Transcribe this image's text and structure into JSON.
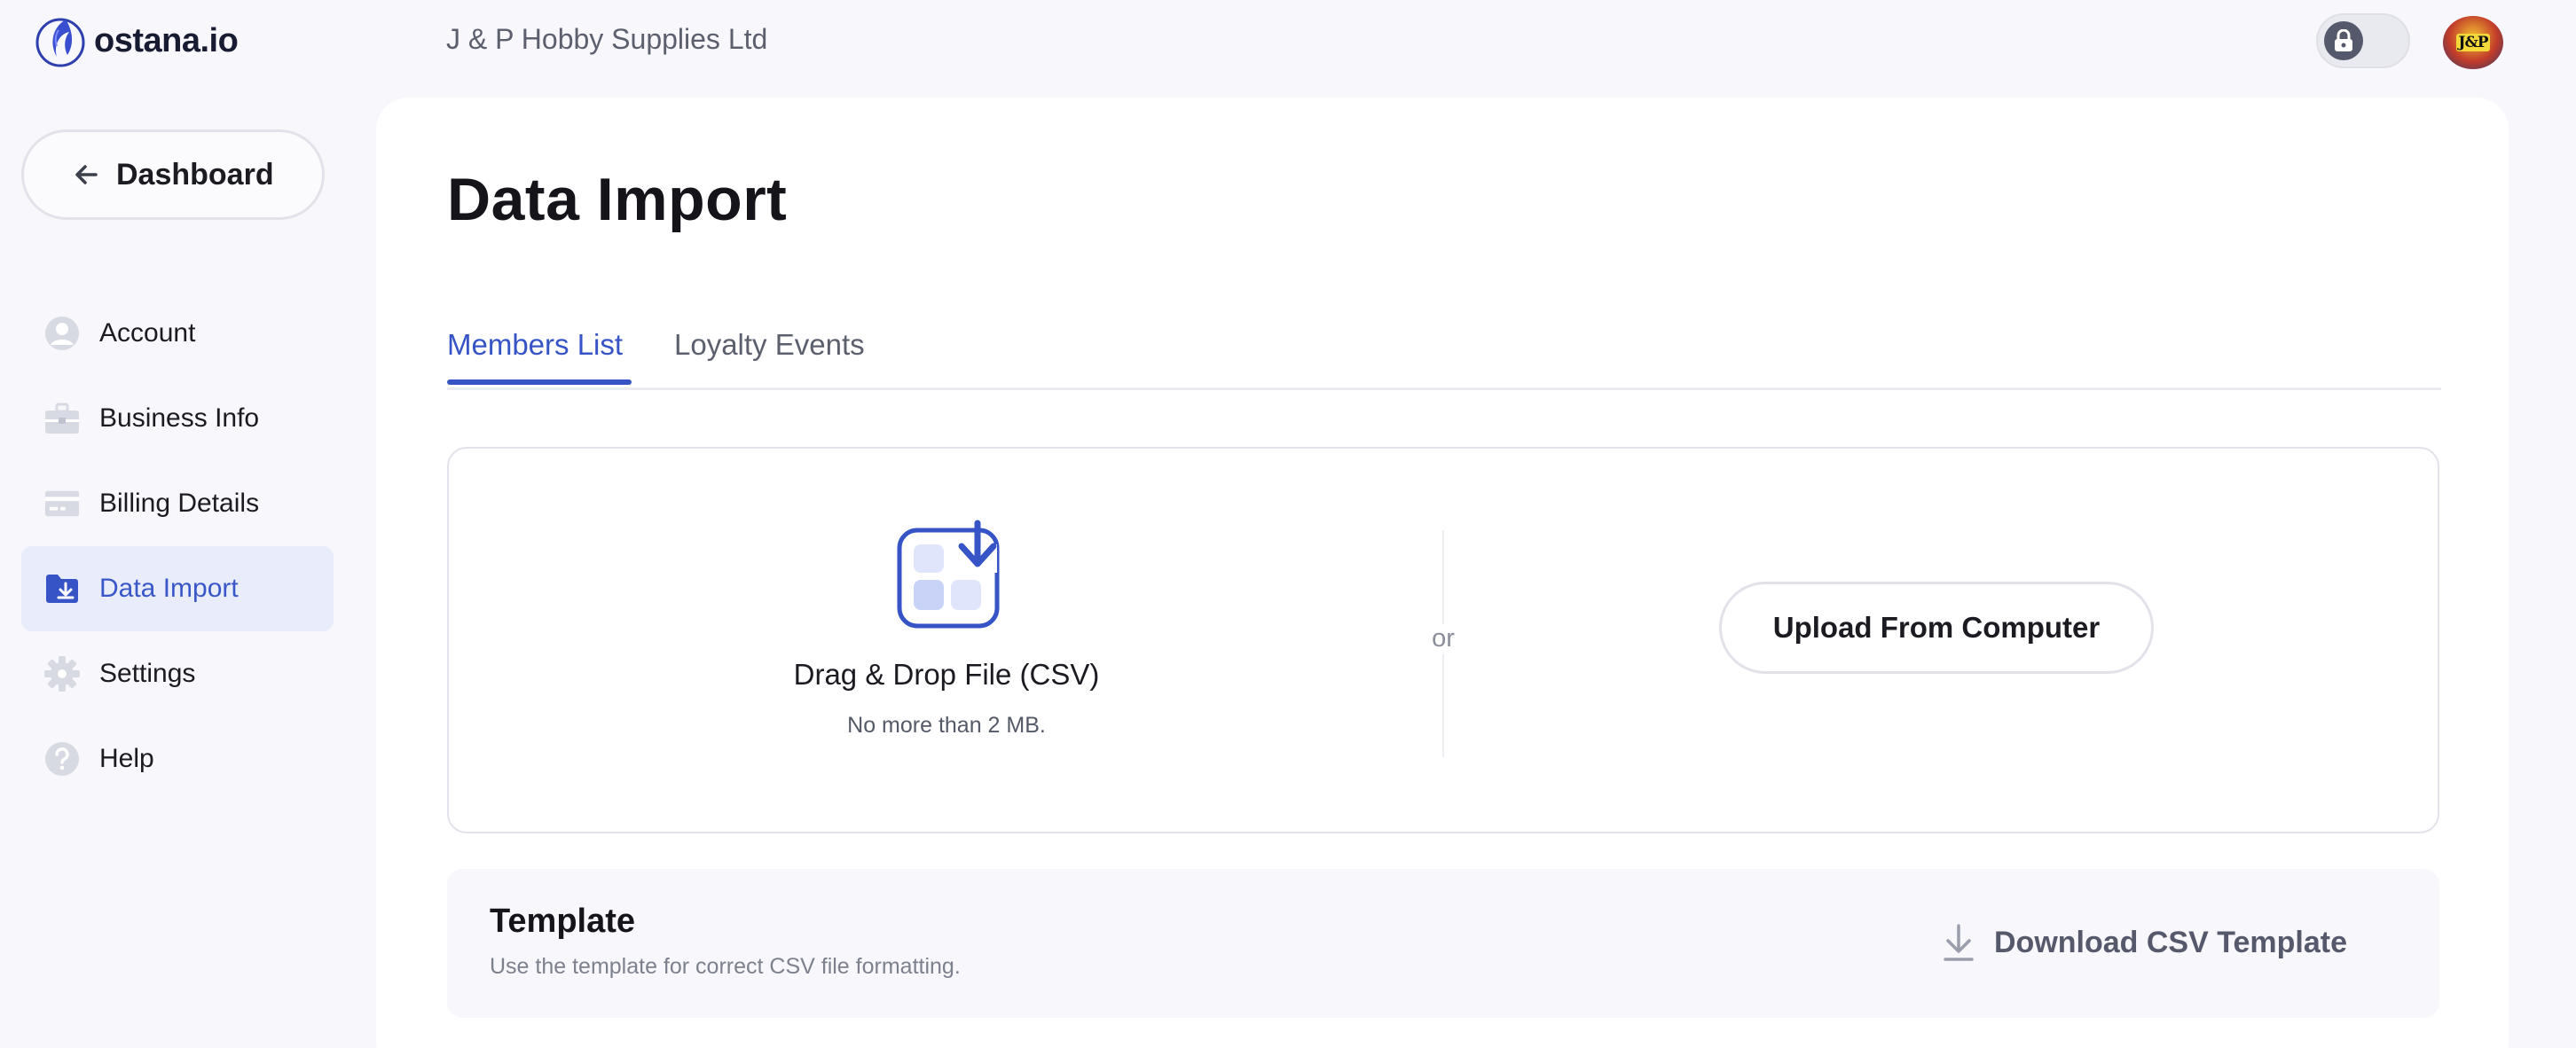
{
  "app": {
    "logo_text": "ostana.io",
    "organization": "J & P Hobby Supplies Ltd",
    "avatar_text": "J&P"
  },
  "topbar": {
    "theme_toggle_icon": "lock-icon"
  },
  "sidebar": {
    "back_label": "Dashboard",
    "items": [
      {
        "label": "Account",
        "icon": "user-icon",
        "active": false
      },
      {
        "label": "Business Info",
        "icon": "briefcase-icon",
        "active": false
      },
      {
        "label": "Billing Details",
        "icon": "credit-card-icon",
        "active": false
      },
      {
        "label": "Data Import",
        "icon": "folder-import-icon",
        "active": true
      },
      {
        "label": "Settings",
        "icon": "gear-icon",
        "active": false
      },
      {
        "label": "Help",
        "icon": "help-icon",
        "active": false
      }
    ]
  },
  "main": {
    "title": "Data Import",
    "tabs": [
      {
        "label": "Members List",
        "active": true
      },
      {
        "label": "Loyalty Events",
        "active": false
      }
    ],
    "upload": {
      "drop_title": "Drag & Drop File (CSV)",
      "drop_subtitle": "No more than 2 MB.",
      "or_text": "or",
      "upload_button": "Upload From Computer"
    },
    "template": {
      "title": "Template",
      "subtitle": "Use the template for correct CSV file formatting.",
      "download_label": "Download CSV Template"
    }
  },
  "colors": {
    "accent": "#3654c6",
    "active_bg": "#e8ecfb",
    "page_bg": "#f7f7fc"
  }
}
